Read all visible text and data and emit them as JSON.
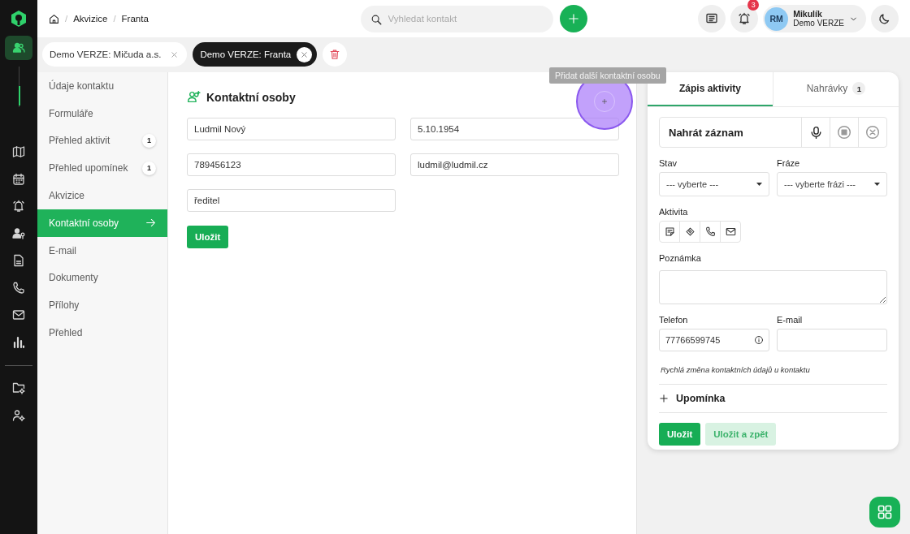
{
  "rail": [
    {
      "kind": "contacts",
      "selected": true
    },
    {
      "kind": "map",
      "selected": false
    },
    {
      "kind": "calendar",
      "selected": false
    },
    {
      "kind": "bell",
      "selected": false
    },
    {
      "kind": "contact-key",
      "selected": false
    },
    {
      "kind": "document",
      "selected": false
    },
    {
      "kind": "phone",
      "selected": false
    },
    {
      "kind": "mail",
      "selected": false
    },
    {
      "kind": "chart",
      "selected": false
    },
    {
      "kind": "folder-settings",
      "selected": false
    },
    {
      "kind": "user-settings",
      "selected": false
    }
  ],
  "breadcrumb": [
    {
      "separator": "/",
      "label": "Akvizice"
    },
    {
      "separator": "/",
      "label": "Franta"
    }
  ],
  "search": {
    "placeholder": "Vyhledat kontakt"
  },
  "notifications": {
    "count": "3"
  },
  "user": {
    "initials": "RM",
    "name": "Mikulík",
    "company": "Demo VERZE"
  },
  "tabs": [
    {
      "label": "Demo VERZE: Mičuda a.s.",
      "selected": false
    },
    {
      "label": "Demo VERZE: Franta",
      "selected": true
    }
  ],
  "nav": [
    {
      "label": "Údaje kontaktu",
      "selected": false
    },
    {
      "label": "Formuláře",
      "selected": false
    },
    {
      "label": "Přehled aktivit",
      "count": "1",
      "selected": false
    },
    {
      "label": "Přehled upomínek",
      "count": "1",
      "selected": false
    },
    {
      "label": "Akvizice",
      "selected": false
    },
    {
      "label": "Kontaktní osoby",
      "selected": true
    },
    {
      "label": "E-mail",
      "selected": false
    },
    {
      "label": "Dokumenty",
      "selected": false
    },
    {
      "label": "Přílohy",
      "selected": false
    },
    {
      "label": "Přehled",
      "selected": false
    }
  ],
  "contact_section": {
    "title": "Kontaktní osoby",
    "tooltip": "Přidat další kontaktní osobu",
    "fields": [
      {
        "value": "Ludmil Nový"
      },
      {
        "value": "5.10.1954"
      },
      {
        "value": "789456123"
      },
      {
        "value": "ludmil@ludmil.cz"
      },
      {
        "value": "ředitel"
      }
    ],
    "save": "Uložit"
  },
  "activity": {
    "tabs": [
      {
        "label": "Zápis aktivity",
        "selected": true
      },
      {
        "label": "Nahrávky",
        "count": "1",
        "selected": false
      }
    ],
    "record": "Nahrát záznam",
    "stav": {
      "label": "Stav",
      "value": "--- vyberte ---"
    },
    "fraze": {
      "label": "Fráze",
      "value": "--- vyberte frázi ---"
    },
    "activity_label": "Aktivita",
    "note_label": "Poznámka",
    "phone": {
      "label": "Telefon",
      "value": "77766599745"
    },
    "email": {
      "label": "E-mail"
    },
    "hint": "Rychlá změna kontaktních údajů u kontaktu",
    "reminder": "Upomínka",
    "buttons": [
      "Uložit",
      "Uložit a zpět"
    ]
  }
}
